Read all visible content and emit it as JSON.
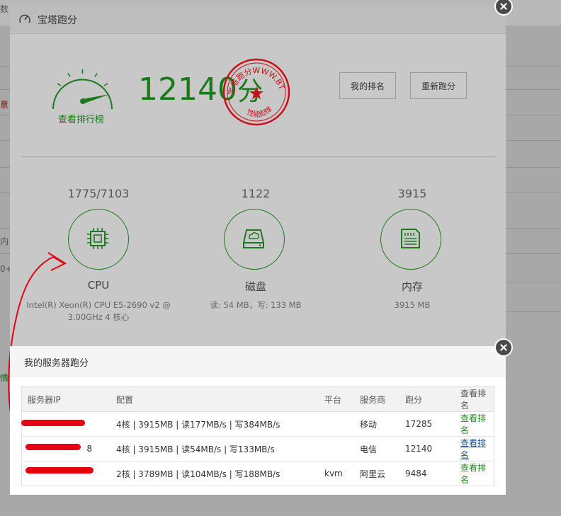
{
  "background": {
    "fragments": [
      "数",
      "意",
      "内",
      "0+",
      "情"
    ]
  },
  "benchmark_modal": {
    "title": "宝塔跑分",
    "rank_board_link": "查看排行榜",
    "score": "12140",
    "score_unit": "分",
    "stamp_text_top": "宝塔跑分WWW.BT.CN",
    "stamp_text_bottom": "性能彪悍",
    "my_rank_button": "我的排名",
    "rerun_button": "重新跑分",
    "metrics": [
      {
        "value": "1775/7103",
        "name": "CPU",
        "desc": "Intel(R) Xeon(R) CPU E5-2690 v2 @ 3.00GHz 4 核心"
      },
      {
        "value": "1122",
        "name": "磁盘",
        "desc": "读: 54 MB，写: 133 MB"
      },
      {
        "value": "3915",
        "name": "内存",
        "desc": "3915 MB"
      }
    ]
  },
  "ranking_modal": {
    "title": "我的服务器跑分",
    "headers": [
      "服务器IP",
      "配置",
      "平台",
      "服务商",
      "跑分",
      "查看排名"
    ],
    "rows": [
      {
        "ip": "",
        "config": "4核 | 3915MB | 读177MB/s | 写384MB/s",
        "platform": "",
        "provider": "移动",
        "score": "17285",
        "action": "查看排名"
      },
      {
        "ip": "8",
        "config": "4核 | 3915MB | 读54MB/s | 写133MB/s",
        "platform": "",
        "provider": "电信",
        "score": "12140",
        "action": "查看排名"
      },
      {
        "ip": "",
        "config": "2核 | 3789MB | 读104MB/s | 写188MB/s",
        "platform": "kvm",
        "provider": "阿里云",
        "score": "9484",
        "action": "查看排名"
      }
    ]
  },
  "colors": {
    "accent_green": "#1a7a1a",
    "annotation_red": "#e60012"
  }
}
